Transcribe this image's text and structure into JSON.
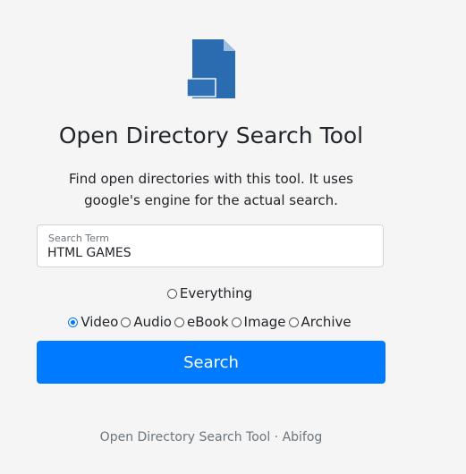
{
  "app": {
    "title": "Open Directory Search Tool",
    "description": "Find open directories with this tool. It uses google's engine for the actual search."
  },
  "search_field": {
    "label": "Search Term",
    "value": "HTML GAMES"
  },
  "options": {
    "everything": {
      "label": "Everything",
      "checked": false
    },
    "media": [
      {
        "label": "Video",
        "checked": true
      },
      {
        "label": "Audio",
        "checked": false
      },
      {
        "label": "eBook",
        "checked": false
      },
      {
        "label": "Image",
        "checked": false
      },
      {
        "label": "Archive",
        "checked": false
      }
    ]
  },
  "search_button": {
    "label": "Search"
  },
  "footer": {
    "text": "Open Directory Search Tool · Abifog"
  },
  "colors": {
    "accent": "#007bff",
    "logo": "#2b6cb0",
    "background": "#f5f5f5"
  },
  "icons": {
    "logo": "file-icon"
  }
}
